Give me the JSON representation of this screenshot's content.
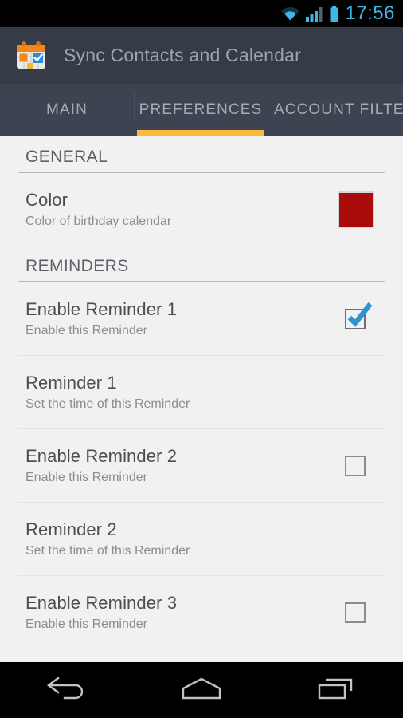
{
  "status_bar": {
    "time": "17:56",
    "icons": [
      "wifi-icon",
      "signal-icon",
      "battery-icon"
    ],
    "accent_color": "#3FB6E8",
    "background": "#000000"
  },
  "action_bar": {
    "app_icon": "calendar-sync-app-icon",
    "title": "Sync Contacts and Calendar",
    "background": "#353B47",
    "title_color": "#9FA3AC"
  },
  "tabs": {
    "active_index": 1,
    "indicator_color": "#FBBA3A",
    "background": "#3D4350",
    "items": [
      {
        "label": "MAIN",
        "active": false
      },
      {
        "label": "PREFERENCES",
        "active": true
      },
      {
        "label": "ACCOUNT FILTER",
        "active": false
      }
    ]
  },
  "content": {
    "background": "#F1F1F1",
    "sections": [
      {
        "header": "GENERAL",
        "rows": [
          {
            "title": "Color",
            "subtitle": "Color of birthday calendar",
            "widget": "color-swatch",
            "color": "#A90A0A"
          }
        ]
      },
      {
        "header": "REMINDERS",
        "rows": [
          {
            "title": "Enable Reminder 1",
            "subtitle": "Enable this Reminder",
            "widget": "checkbox",
            "checked": true
          },
          {
            "title": "Reminder 1",
            "subtitle": "Set the time of this Reminder",
            "widget": "none",
            "checked": false
          },
          {
            "title": "Enable Reminder 2",
            "subtitle": "Enable this Reminder",
            "widget": "checkbox",
            "checked": false
          },
          {
            "title": "Reminder 2",
            "subtitle": "Set the time of this Reminder",
            "widget": "none",
            "checked": false
          },
          {
            "title": "Enable Reminder 3",
            "subtitle": "Enable this Reminder",
            "widget": "checkbox",
            "checked": false
          }
        ]
      }
    ]
  },
  "nav_bar": {
    "background": "#000000",
    "buttons": [
      {
        "name": "back-icon"
      },
      {
        "name": "home-icon"
      },
      {
        "name": "recents-icon"
      }
    ]
  }
}
